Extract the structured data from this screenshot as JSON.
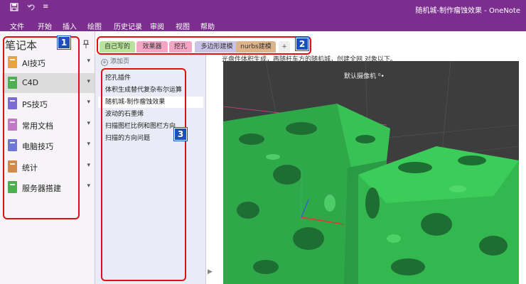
{
  "titlebar": {
    "save_icon": "save-icon",
    "undo_icon": "undo-icon",
    "customize_glyph": "≡",
    "window_title": "随机城-制作瘤蚀效果  -  OneNote"
  },
  "menu": {
    "items": [
      "文件",
      "开始",
      "插入",
      "绘图",
      "历史记录",
      "审阅",
      "视图",
      "帮助"
    ]
  },
  "notebooks": {
    "header": "笔记本",
    "items": [
      {
        "label": "AI技巧",
        "color": "#e8a33d"
      },
      {
        "label": "C4D",
        "color": "#4caf50"
      },
      {
        "label": "PS技巧",
        "color": "#7c6bd4"
      },
      {
        "label": "常用文档",
        "color": "#c27ac6"
      },
      {
        "label": "电脑技巧",
        "color": "#6f76d9"
      },
      {
        "label": "统计",
        "color": "#d38a49"
      },
      {
        "label": "服务器搭建",
        "color": "#4caf50"
      }
    ],
    "selected_index": 1
  },
  "sections": {
    "tabs": [
      {
        "label": "自己写的",
        "color": "#b9e39a"
      },
      {
        "label": "效果器",
        "color": "#f3a6c4"
      },
      {
        "label": "挖孔",
        "color": "#f3a6c4"
      },
      {
        "label": "多边形建模",
        "color": "#c9c4e6"
      },
      {
        "label": "nurbs建模",
        "color": "#ddb48a"
      }
    ],
    "add_label": "+"
  },
  "pages": {
    "add_label": "添加页",
    "items": [
      "挖孔插件",
      "体积生成替代复杂布尔运算",
      "随机城-制作瘤蚀效果",
      "波动的石墨烯",
      "扫描图栏比例和图栏方向",
      "扫描的方向问题"
    ],
    "selected_index": 2
  },
  "content": {
    "text_line": "光盘件体积生成，再随杆车方的随机城，创建全网 对象以下。",
    "camera_label": "默认摄像机 ⁰•",
    "viewport_colors": {
      "background": "#3d3d3d",
      "object": "#2fa84a",
      "hole": "#1e6e33"
    }
  },
  "annotations": [
    {
      "number": "1"
    },
    {
      "number": "2"
    },
    {
      "number": "3"
    }
  ]
}
